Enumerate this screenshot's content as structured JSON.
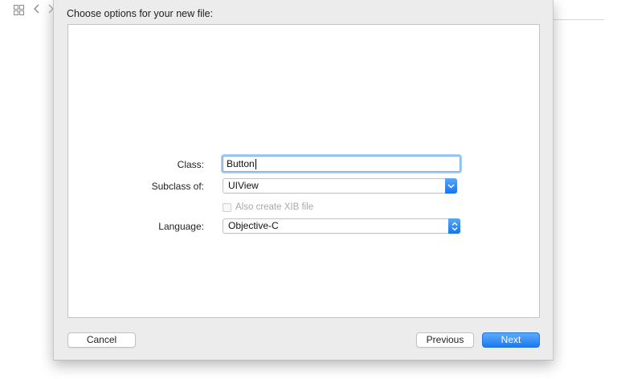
{
  "background_window": {
    "icons": [
      "grid-icon",
      "chevron-left-icon",
      "chevron-right-icon"
    ]
  },
  "sheet": {
    "title": "Choose options for your new file:",
    "form": {
      "class_label": "Class:",
      "class_value": "Button",
      "subclass_label": "Subclass of:",
      "subclass_value": "UIView",
      "xib_checkbox_label": "Also create XIB file",
      "xib_checkbox_checked": false,
      "language_label": "Language:",
      "language_value": "Objective-C"
    },
    "buttons": {
      "cancel": "Cancel",
      "previous": "Previous",
      "next": "Next"
    }
  },
  "colors": {
    "accent": "#1b7af0",
    "focus_ring": "#a6ccf3",
    "sheet_bg": "#ececec"
  }
}
